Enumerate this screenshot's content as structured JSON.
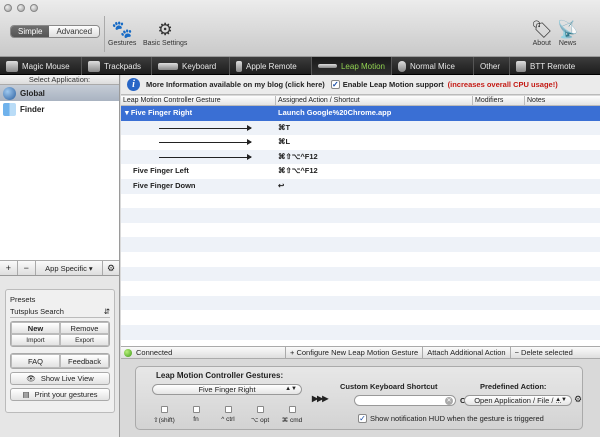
{
  "toolbar": {
    "mode_simple": "Simple",
    "mode_advanced": "Advanced",
    "gestures_label": "Gestures",
    "settings_label": "Basic Settings",
    "about_label": "About",
    "news_label": "News"
  },
  "device_tabs": [
    {
      "label": "Magic Mouse",
      "icon": "mouse-icon"
    },
    {
      "label": "Trackpads",
      "icon": "trackpad-icon"
    },
    {
      "label": "Keyboard",
      "icon": "keyboard-icon"
    },
    {
      "label": "Apple Remote",
      "icon": "remote-icon"
    },
    {
      "label": "Leap Motion",
      "icon": "leap-motion-icon",
      "active": true
    },
    {
      "label": "Normal Mice",
      "icon": "mouse-icon"
    },
    {
      "label": "Other",
      "icon": ""
    },
    {
      "label": "BTT Remote",
      "icon": "btt-remote-icon"
    }
  ],
  "sidebar": {
    "header": "Select Application:",
    "apps": [
      {
        "name": "Global",
        "selected": true
      },
      {
        "name": "Finder",
        "selected": false
      }
    ],
    "add": "+",
    "remove": "−",
    "app_specific": "App Specific ▾",
    "presets_label": "Presets",
    "preset_value": "Tutsplus Search",
    "new": "New",
    "remove_preset": "Remove",
    "import": "Import",
    "export": "Export",
    "faq": "FAQ",
    "feedback": "Feedback",
    "show_live_view": "Show Live View",
    "print_gestures": "Print your gestures"
  },
  "infobar": {
    "blog_text": "More Information available on my blog (click here)",
    "enable_label": "Enable Leap Motion support",
    "enable_checked": "✓",
    "cpu_warning": "(increases overall CPU usage!)"
  },
  "table": {
    "headers": [
      "Leap Motion Controller Gesture",
      "Assigned Action / Shortcut",
      "Modifiers",
      "Notes"
    ],
    "rows": [
      {
        "gesture": "▾ Five Finger Right",
        "action": "Launch Google%20Chrome.app"
      },
      {
        "gesture": "",
        "action": "⌘T"
      },
      {
        "gesture": "",
        "action": "⌘L"
      },
      {
        "gesture": "",
        "action": "⌘⇧⌥^F12"
      },
      {
        "gesture": "Five Finger Left",
        "action": "⌘⇧⌥^F12"
      },
      {
        "gesture": "Five Finger Down",
        "action": "↩"
      }
    ]
  },
  "actions": {
    "status": "Connected",
    "configure": "+ Configure New Leap Motion Gesture",
    "attach": "Attach Additional Action",
    "delete": "− Delete selected"
  },
  "config_panel": {
    "gestures_title": "Leap Motion Controller Gestures:",
    "gesture_selected": "Five Finger Right",
    "shortcut_title": "Custom Keyboard Shortcut",
    "or": "OR",
    "predefined_title": "Predefined Action:",
    "predefined_value": "Open Application / File / ...",
    "play": "▶▶▶",
    "modifiers": [
      "⇧(shift)",
      "fn",
      "^ ctrl",
      "⌥ opt",
      "⌘ cmd"
    ],
    "hud_label": "Show notification HUD when the gesture is triggered",
    "hud_checked": "✓"
  }
}
